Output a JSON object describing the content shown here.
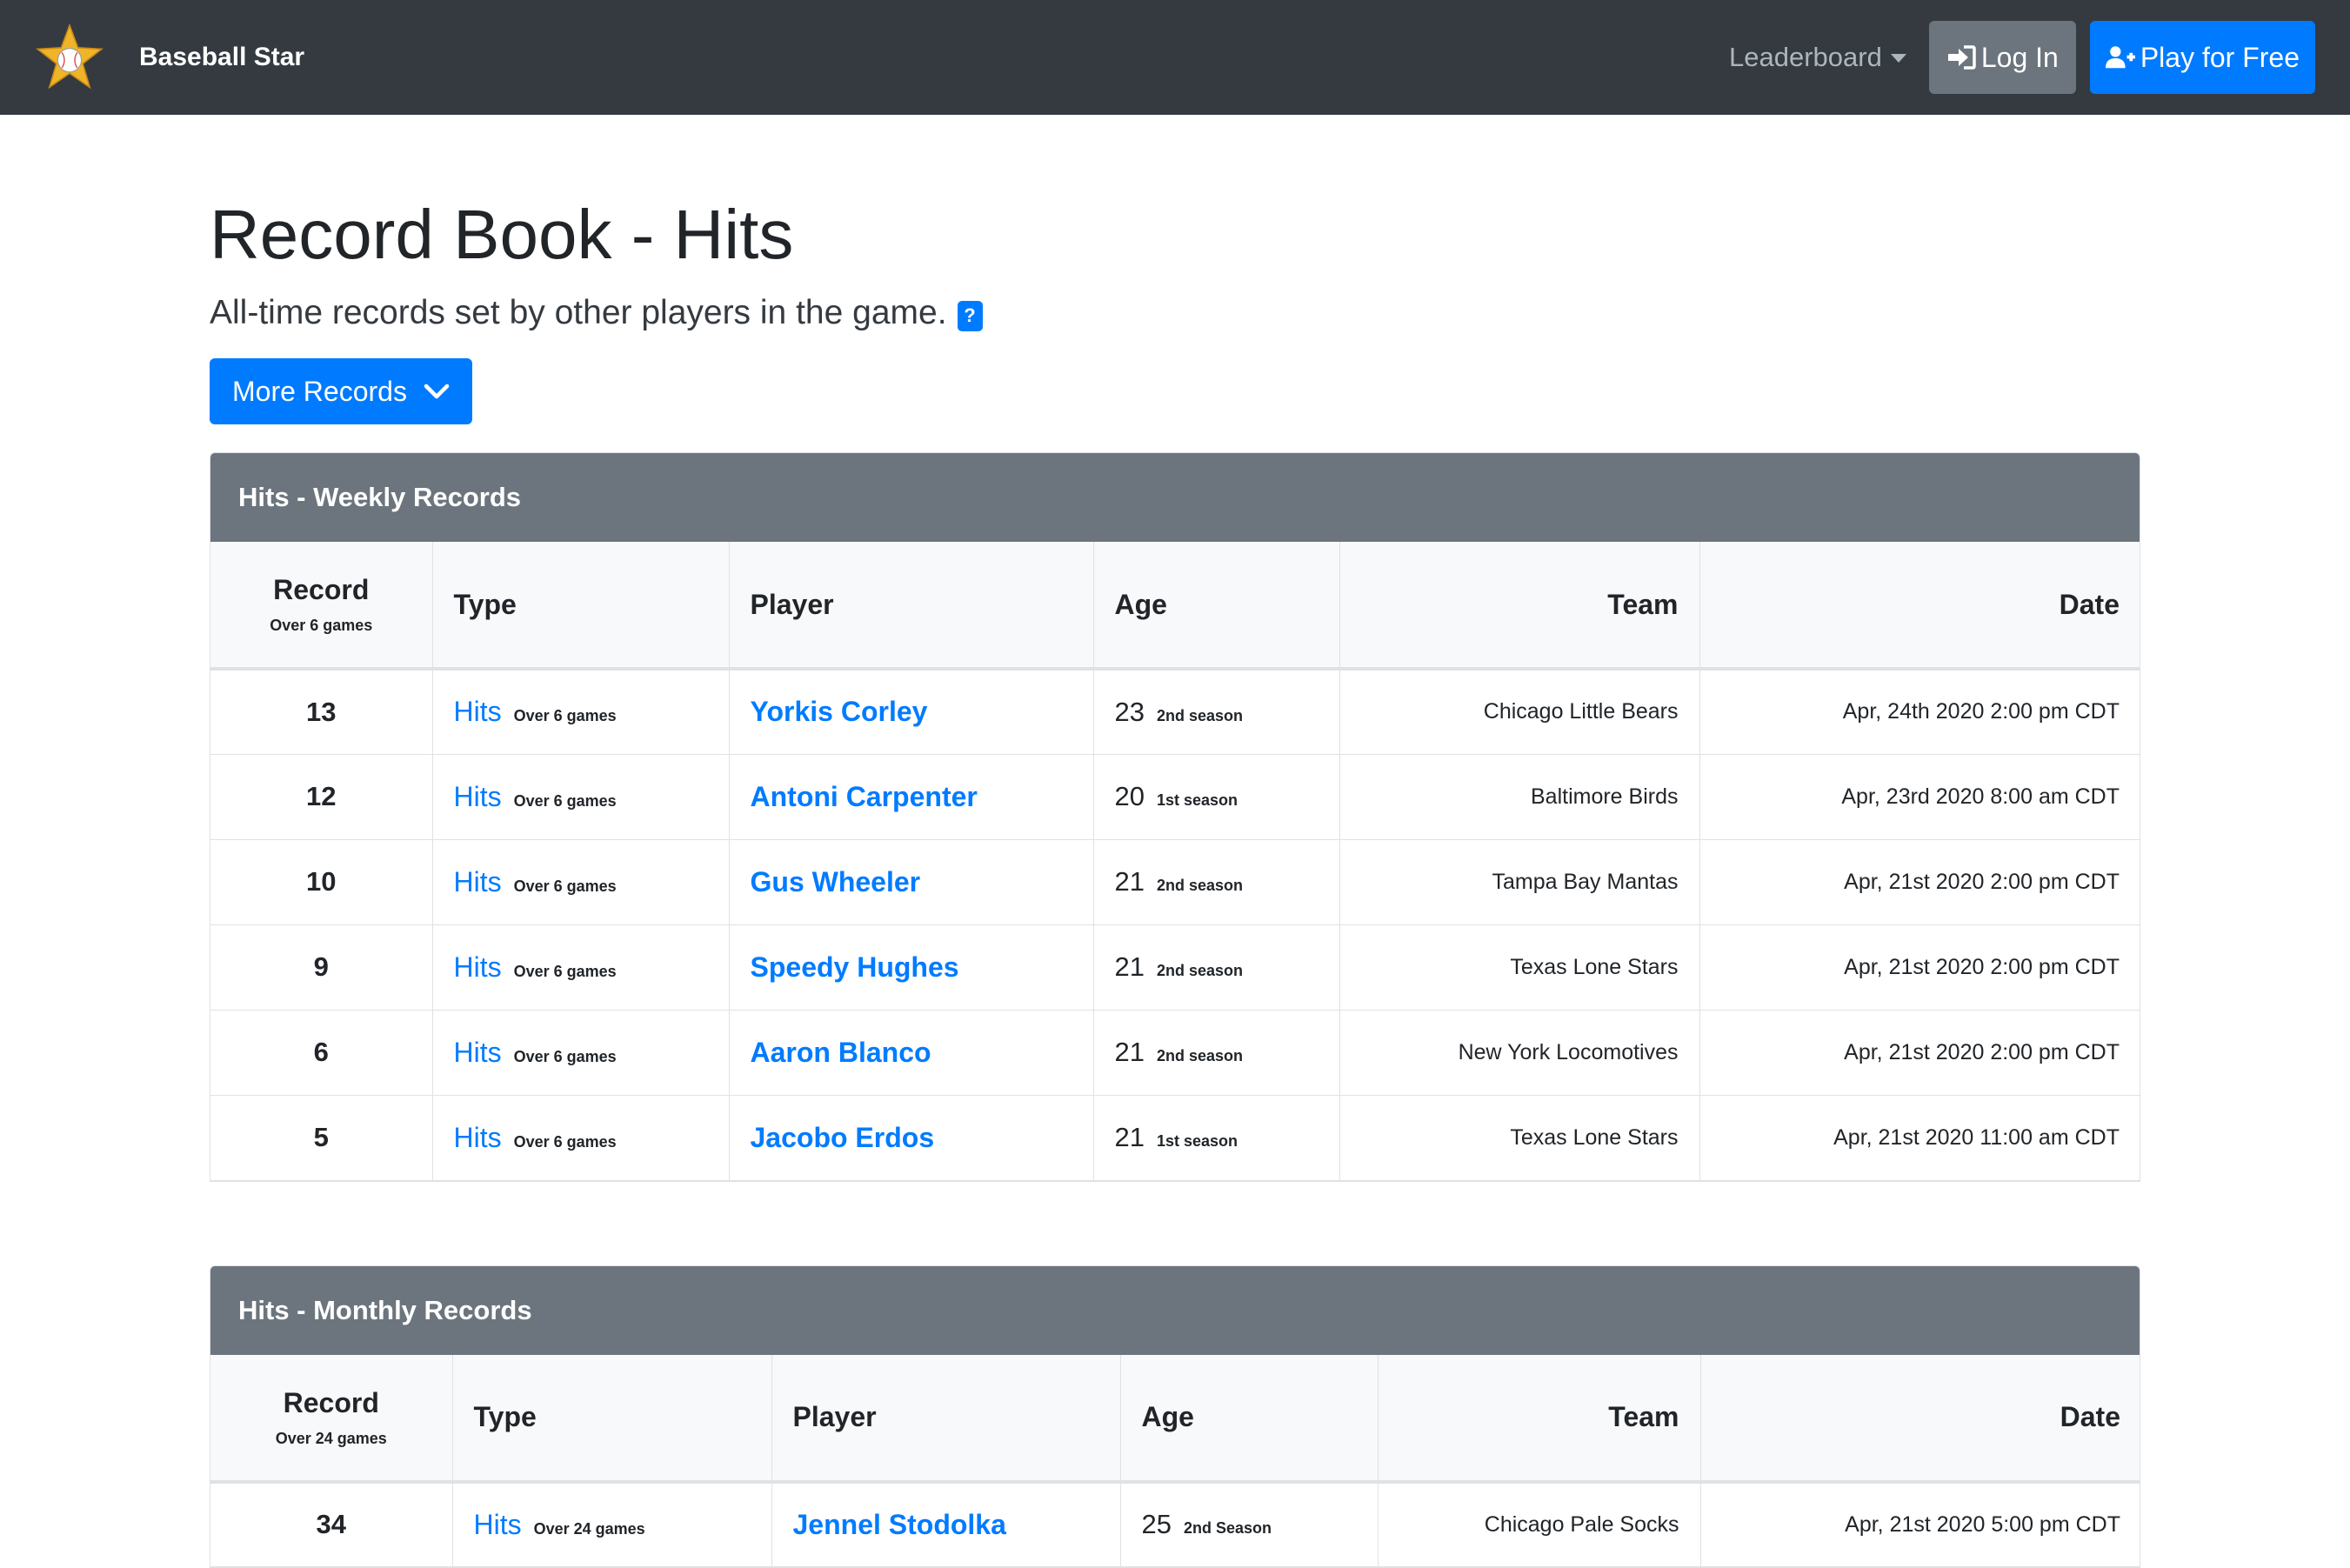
{
  "navbar": {
    "brand": "Baseball Star",
    "leaderboard": "Leaderboard",
    "login": "Log In",
    "play": "Play for Free"
  },
  "page": {
    "title": "Record Book - Hits",
    "subtitle": "All-time records set by other players in the game.",
    "help_badge": "?",
    "more_records": "More Records"
  },
  "colors": {
    "navbar_bg": "#343a40",
    "primary": "#007bff",
    "secondary": "#6c757d",
    "star": "#f0b429"
  },
  "weekly": {
    "header": "Hits - Weekly Records",
    "columns": {
      "record": "Record",
      "record_sub": "Over 6 games",
      "type": "Type",
      "player": "Player",
      "age": "Age",
      "team": "Team",
      "date": "Date"
    },
    "rows": [
      {
        "record": "13",
        "type": "Hits",
        "type_note": "Over 6 games",
        "player": "Yorkis Corley",
        "age": "23",
        "season": "2nd season",
        "team": "Chicago Little Bears",
        "date": "Apr, 24th 2020 2:00 pm CDT"
      },
      {
        "record": "12",
        "type": "Hits",
        "type_note": "Over 6 games",
        "player": "Antoni Carpenter",
        "age": "20",
        "season": "1st season",
        "team": "Baltimore Birds",
        "date": "Apr, 23rd 2020 8:00 am CDT"
      },
      {
        "record": "10",
        "type": "Hits",
        "type_note": "Over 6 games",
        "player": "Gus Wheeler",
        "age": "21",
        "season": "2nd season",
        "team": "Tampa Bay Mantas",
        "date": "Apr, 21st 2020 2:00 pm CDT"
      },
      {
        "record": "9",
        "type": "Hits",
        "type_note": "Over 6 games",
        "player": "Speedy Hughes",
        "age": "21",
        "season": "2nd season",
        "team": "Texas Lone Stars",
        "date": "Apr, 21st 2020 2:00 pm CDT"
      },
      {
        "record": "6",
        "type": "Hits",
        "type_note": "Over 6 games",
        "player": "Aaron Blanco",
        "age": "21",
        "season": "2nd season",
        "team": "New York Locomotives",
        "date": "Apr, 21st 2020 2:00 pm CDT"
      },
      {
        "record": "5",
        "type": "Hits",
        "type_note": "Over 6 games",
        "player": "Jacobo Erdos",
        "age": "21",
        "season": "1st season",
        "team": "Texas Lone Stars",
        "date": "Apr, 21st 2020 11:00 am CDT"
      }
    ]
  },
  "monthly": {
    "header": "Hits - Monthly Records",
    "columns": {
      "record": "Record",
      "record_sub": "Over 24 games",
      "type": "Type",
      "player": "Player",
      "age": "Age",
      "team": "Team",
      "date": "Date"
    },
    "rows": [
      {
        "record": "34",
        "type": "Hits",
        "type_note": "Over 24 games",
        "player": "Jennel Stodolka",
        "age": "25",
        "season": "2nd Season",
        "team": "Chicago Pale Socks",
        "date": "Apr, 21st 2020 5:00 pm CDT"
      }
    ]
  }
}
